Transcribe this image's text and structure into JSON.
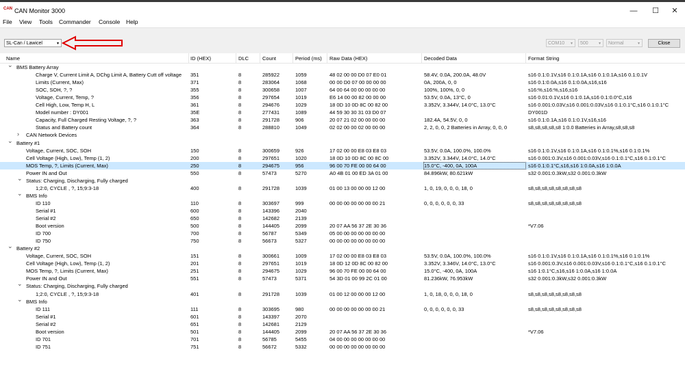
{
  "window": {
    "title": "CAN Monitor 3000",
    "logo_text": "CAN",
    "minimize": "—",
    "maximize": "☐",
    "close": "✕"
  },
  "menu": [
    "File",
    "View",
    "Tools",
    "Commander",
    "Console",
    "Help"
  ],
  "toolbar": {
    "interface": "SL-Can / Lawicel",
    "port": "COM10",
    "bitrate": "500",
    "mode": "Normal",
    "close_label": "Close"
  },
  "columns": [
    "Name",
    "ID (HEX)",
    "DLC",
    "Count",
    "Period (ms)",
    "Raw Data (HEX)",
    "Decoded Data",
    "Format String"
  ],
  "rows": [
    {
      "level": 0,
      "toggle": "v",
      "name": "BMS Battery Array",
      "id": "",
      "dlc": "",
      "count": "",
      "period": "",
      "raw": "",
      "decoded": "",
      "format": ""
    },
    {
      "level": 2,
      "toggle": "",
      "name": "Charge V, Current Limit A, DChg Limit A, Battery Cutt off voltage",
      "id": "351",
      "dlc": "8",
      "count": "285922",
      "period": "1059",
      "raw": "48 02 00 00 D0 07 E0 01",
      "decoded": "58.4V, 0.0A, 200.0A, 48.0V",
      "format": "s16 0.1:0.1V,s16 0.1:0.1A,s16 0.1:0.1A,s16 0.1:0.1V"
    },
    {
      "level": 2,
      "toggle": "",
      "name": "Limits (Current, Max)",
      "id": "371",
      "dlc": "8",
      "count": "283064",
      "period": "1068",
      "raw": "00 00 D0 07 00 00 00 00",
      "decoded": "0A, 200A, 0, 0",
      "format": "s16 0.1:0.0A,s16 0.1:0.0A,s16,s16"
    },
    {
      "level": 2,
      "toggle": "",
      "name": "SOC, SOH, ?, ?",
      "id": "355",
      "dlc": "8",
      "count": "300658",
      "period": "1007",
      "raw": "64 00 64 00 00 00 00 00",
      "decoded": "100%, 100%, 0, 0",
      "format": "s16:%,s16:%,s16,s16"
    },
    {
      "level": 2,
      "toggle": "",
      "name": "Voltage, Current, Temp, ?",
      "id": "356",
      "dlc": "8",
      "count": "297654",
      "period": "1019",
      "raw": "E6 14 00 00 82 00 00 00",
      "decoded": "53.5V, 0.0A, 13°C, 0",
      "format": "s16 0.01:0.1V,s16 0.1:0.1A,s16 0.1:0.0°C,s16"
    },
    {
      "level": 2,
      "toggle": "",
      "name": "Cell High, Low, Temp H, L",
      "id": "361",
      "dlc": "8",
      "count": "294676",
      "period": "1029",
      "raw": "18 0D 10 0D 8C 00 82 00",
      "decoded": "3.352V, 3.344V, 14.0°C, 13.0°C",
      "format": "s16 0.001:0.03V,s16 0.001:0.03V,s16 0.1:0.1°C,s16 0.1:0.1°C"
    },
    {
      "level": 2,
      "toggle": "",
      "name": "Model number : DY001",
      "id": "35E",
      "dlc": "8",
      "count": "277431",
      "period": "1089",
      "raw": "44 59 30 30 31 03 D0 07",
      "decoded": "",
      "format": "DY001D"
    },
    {
      "level": 2,
      "toggle": "",
      "name": "Capacity, Full Charged Resting Voltage, ?, ?",
      "id": "363",
      "dlc": "8",
      "count": "291728",
      "period": "906",
      "raw": "20 07 21 02 00 00 00 00",
      "decoded": "182.4A, 54.5V, 0, 0",
      "format": "s16 0.1:0.1A,s16 0.1:0.1V,s16,s16"
    },
    {
      "level": 2,
      "toggle": "",
      "name": "Status and Battery count",
      "id": "364",
      "dlc": "8",
      "count": "288810",
      "period": "1049",
      "raw": "02 02 00 00 02 00 00 00",
      "decoded": "2, 2, 0, 0, 2 Batteries in Array, 0, 0, 0",
      "format": "s8,s8,s8,s8,s8 1:0.0 Batteries in Array,s8,s8,s8"
    },
    {
      "level": 1,
      "toggle": ">",
      "name": "CAN Network Devices",
      "id": "",
      "dlc": "",
      "count": "",
      "period": "",
      "raw": "",
      "decoded": "",
      "format": ""
    },
    {
      "level": 0,
      "toggle": "v",
      "name": "Battery #1",
      "id": "",
      "dlc": "",
      "count": "",
      "period": "",
      "raw": "",
      "decoded": "",
      "format": ""
    },
    {
      "level": 1,
      "toggle": "",
      "name": "Voltage, Current, SOC, SOH",
      "id": "150",
      "dlc": "8",
      "count": "300659",
      "period": "926",
      "raw": "17 02 00 00 E8 03 E8 03",
      "decoded": "53.5V, 0.0A, 100.0%, 100.0%",
      "format": "s16 0.1:0.1V,s16 0.1:0.1A,s16 0.1:0.1%,s16 0.1:0.1%"
    },
    {
      "level": 1,
      "toggle": "",
      "name": "Cell Voltage (High, Low), Temp (1, 2)",
      "id": "200",
      "dlc": "8",
      "count": "297651",
      "period": "1020",
      "raw": "18 0D 10 0D 8C 00 8C 00",
      "decoded": "3.352V, 3.344V, 14.0°C, 14.0°C",
      "format": "s16 0.001:0.3V,s16 0.001:0.03V,s16 0.1:0.1°C,s16 0.1:0.1°C"
    },
    {
      "level": 1,
      "toggle": "",
      "name": "MOS Temp, ?, Limits (Current, Max)",
      "id": "250",
      "dlc": "8",
      "count": "294675",
      "period": "956",
      "raw": "96 00 70 FE 00 00 64 00",
      "decoded": "15.0°C, -400, 0A, 100A",
      "format": "s16 0.1:0.1°C,s16,s16 1:0.0A,s16 1:0.0A",
      "selected": true
    },
    {
      "level": 1,
      "toggle": "",
      "name": "Power IN and Out",
      "id": "550",
      "dlc": "8",
      "count": "57473",
      "period": "5270",
      "raw": "A0 4B 01 00 ED 3A 01 00",
      "decoded": "84.896kW, 80.621kW",
      "format": "s32 0.001:0.3kW,s32 0.001:0.3kW"
    },
    {
      "level": 1,
      "toggle": "v",
      "name": "Status: Charging, Discharging, Fully charged",
      "id": "",
      "dlc": "",
      "count": "",
      "period": "",
      "raw": "",
      "decoded": "",
      "format": ""
    },
    {
      "level": 2,
      "toggle": "",
      "name": "1;2:0, CYCLE , ?, 15;9:3-18",
      "id": "400",
      "dlc": "8",
      "count": "291728",
      "period": "1039",
      "raw": "01 00 13 00 00 00 12 00",
      "decoded": "1, 0, 19, 0, 0, 0, 18, 0",
      "format": "s8,s8,s8,s8,s8,s8,s8,s8"
    },
    {
      "level": 1,
      "toggle": "v",
      "name": "BMS Info",
      "id": "",
      "dlc": "",
      "count": "",
      "period": "",
      "raw": "",
      "decoded": "",
      "format": ""
    },
    {
      "level": 2,
      "toggle": "",
      "name": "ID 110",
      "id": "110",
      "dlc": "8",
      "count": "303697",
      "period": "999",
      "raw": "00 00 00 00 00 00 00 21",
      "decoded": "0, 0, 0, 0, 0, 0, 33",
      "format": "s8,s8,s8,s8,s8,s8,s8,s8"
    },
    {
      "level": 2,
      "toggle": "",
      "name": "Serial #1",
      "id": "600",
      "dlc": "8",
      "count": "143396",
      "period": "2040",
      "raw": "",
      "decoded": "",
      "format": ""
    },
    {
      "level": 2,
      "toggle": "",
      "name": "Serial #2",
      "id": "650",
      "dlc": "8",
      "count": "142682",
      "period": "2139",
      "raw": "",
      "decoded": "",
      "format": ""
    },
    {
      "level": 2,
      "toggle": "",
      "name": "Boot version",
      "id": "500",
      "dlc": "8",
      "count": "144405",
      "period": "2099",
      "raw": "20 07 AA 56 37 2E 30 36",
      "decoded": "",
      "format": "*V7.06"
    },
    {
      "level": 2,
      "toggle": "",
      "name": "ID 700",
      "id": "700",
      "dlc": "8",
      "count": "56787",
      "period": "5349",
      "raw": "05 00 00 00 00 00 00 00",
      "decoded": "",
      "format": ""
    },
    {
      "level": 2,
      "toggle": "",
      "name": "ID 750",
      "id": "750",
      "dlc": "8",
      "count": "56673",
      "period": "5327",
      "raw": "00 00 00 00 00 00 00 00",
      "decoded": "",
      "format": ""
    },
    {
      "level": 0,
      "toggle": "v",
      "name": "Battery #2",
      "id": "",
      "dlc": "",
      "count": "",
      "period": "",
      "raw": "",
      "decoded": "",
      "format": ""
    },
    {
      "level": 1,
      "toggle": "",
      "name": "Voltage, Current, SOC, SOH",
      "id": "151",
      "dlc": "8",
      "count": "300661",
      "period": "1009",
      "raw": "17 02 00 00 E8 03 E8 03",
      "decoded": "53.5V, 0.0A, 100.0%, 100.0%",
      "format": "s16 0.1:0.1V,s16 0.1:0.1A,s16 0.1:0.1%,s16 0.1:0.1%"
    },
    {
      "level": 1,
      "toggle": "",
      "name": "Cell Voltage (High, Low), Temp (1, 2)",
      "id": "201",
      "dlc": "8",
      "count": "297651",
      "period": "1019",
      "raw": "18 0D 12 0D 8C 00 82 00",
      "decoded": "3.352V, 3.346V, 14.0°C, 13.0°C",
      "format": "s16 0.001:0.3V,s16 0.001:0.03V,s16 0.1:0.1°C,s16 0.1:0.1°C"
    },
    {
      "level": 1,
      "toggle": "",
      "name": "MOS Temp, ?, Limits (Current, Max)",
      "id": "251",
      "dlc": "8",
      "count": "294675",
      "period": "1029",
      "raw": "96 00 70 FE 00 00 64 00",
      "decoded": "15.0°C, -400, 0A, 100A",
      "format": "s16 1:0.1°C,s16,s16 1:0.0A,s16 1:0.0A"
    },
    {
      "level": 1,
      "toggle": "",
      "name": "Power IN and Out",
      "id": "551",
      "dlc": "8",
      "count": "57473",
      "period": "5371",
      "raw": "54 3D 01 00 99 2C 01 00",
      "decoded": "81.236kW, 76.953kW",
      "format": "s32 0.001:0.3kW,s32 0.001:0.3kW"
    },
    {
      "level": 1,
      "toggle": "v",
      "name": "Status: Charging, Discharging, Fully charged",
      "id": "",
      "dlc": "",
      "count": "",
      "period": "",
      "raw": "",
      "decoded": "",
      "format": ""
    },
    {
      "level": 2,
      "toggle": "",
      "name": "1;2:0, CYCLE , ?, 15;9:3-18",
      "id": "401",
      "dlc": "8",
      "count": "291728",
      "period": "1039",
      "raw": "01 00 12 00 00 00 12 00",
      "decoded": "1, 0, 18, 0, 0, 0, 18, 0",
      "format": "s8,s8,s8,s8,s8,s8,s8,s8"
    },
    {
      "level": 1,
      "toggle": "v",
      "name": "BMS Info",
      "id": "",
      "dlc": "",
      "count": "",
      "period": "",
      "raw": "",
      "decoded": "",
      "format": ""
    },
    {
      "level": 2,
      "toggle": "",
      "name": "ID 111",
      "id": "111",
      "dlc": "8",
      "count": "303695",
      "period": "980",
      "raw": "00 00 00 00 00 00 00 21",
      "decoded": "0, 0, 0, 0, 0, 0, 33",
      "format": "s8,s8,s8,s8,s8,s8,s8,s8"
    },
    {
      "level": 2,
      "toggle": "",
      "name": "Serial #1",
      "id": "601",
      "dlc": "8",
      "count": "143397",
      "period": "2070",
      "raw": "",
      "decoded": "",
      "format": ""
    },
    {
      "level": 2,
      "toggle": "",
      "name": "Serial #2",
      "id": "651",
      "dlc": "8",
      "count": "142681",
      "period": "2129",
      "raw": "",
      "decoded": "",
      "format": ""
    },
    {
      "level": 2,
      "toggle": "",
      "name": "Boot version",
      "id": "501",
      "dlc": "8",
      "count": "144405",
      "period": "2099",
      "raw": "20 07 AA 56 37 2E 30 36",
      "decoded": "",
      "format": "*V7.06"
    },
    {
      "level": 2,
      "toggle": "",
      "name": "ID 701",
      "id": "701",
      "dlc": "8",
      "count": "56785",
      "period": "5455",
      "raw": "04 00 00 00 00 00 00 00",
      "decoded": "",
      "format": ""
    },
    {
      "level": 2,
      "toggle": "",
      "name": "ID 751",
      "id": "751",
      "dlc": "8",
      "count": "56672",
      "period": "5332",
      "raw": "00 00 00 00 00 00 00 00",
      "decoded": "",
      "format": ""
    }
  ],
  "colors": {
    "selection": "#cce8ff",
    "annotation_arrow": "#e00000",
    "logo": "#c00000"
  }
}
